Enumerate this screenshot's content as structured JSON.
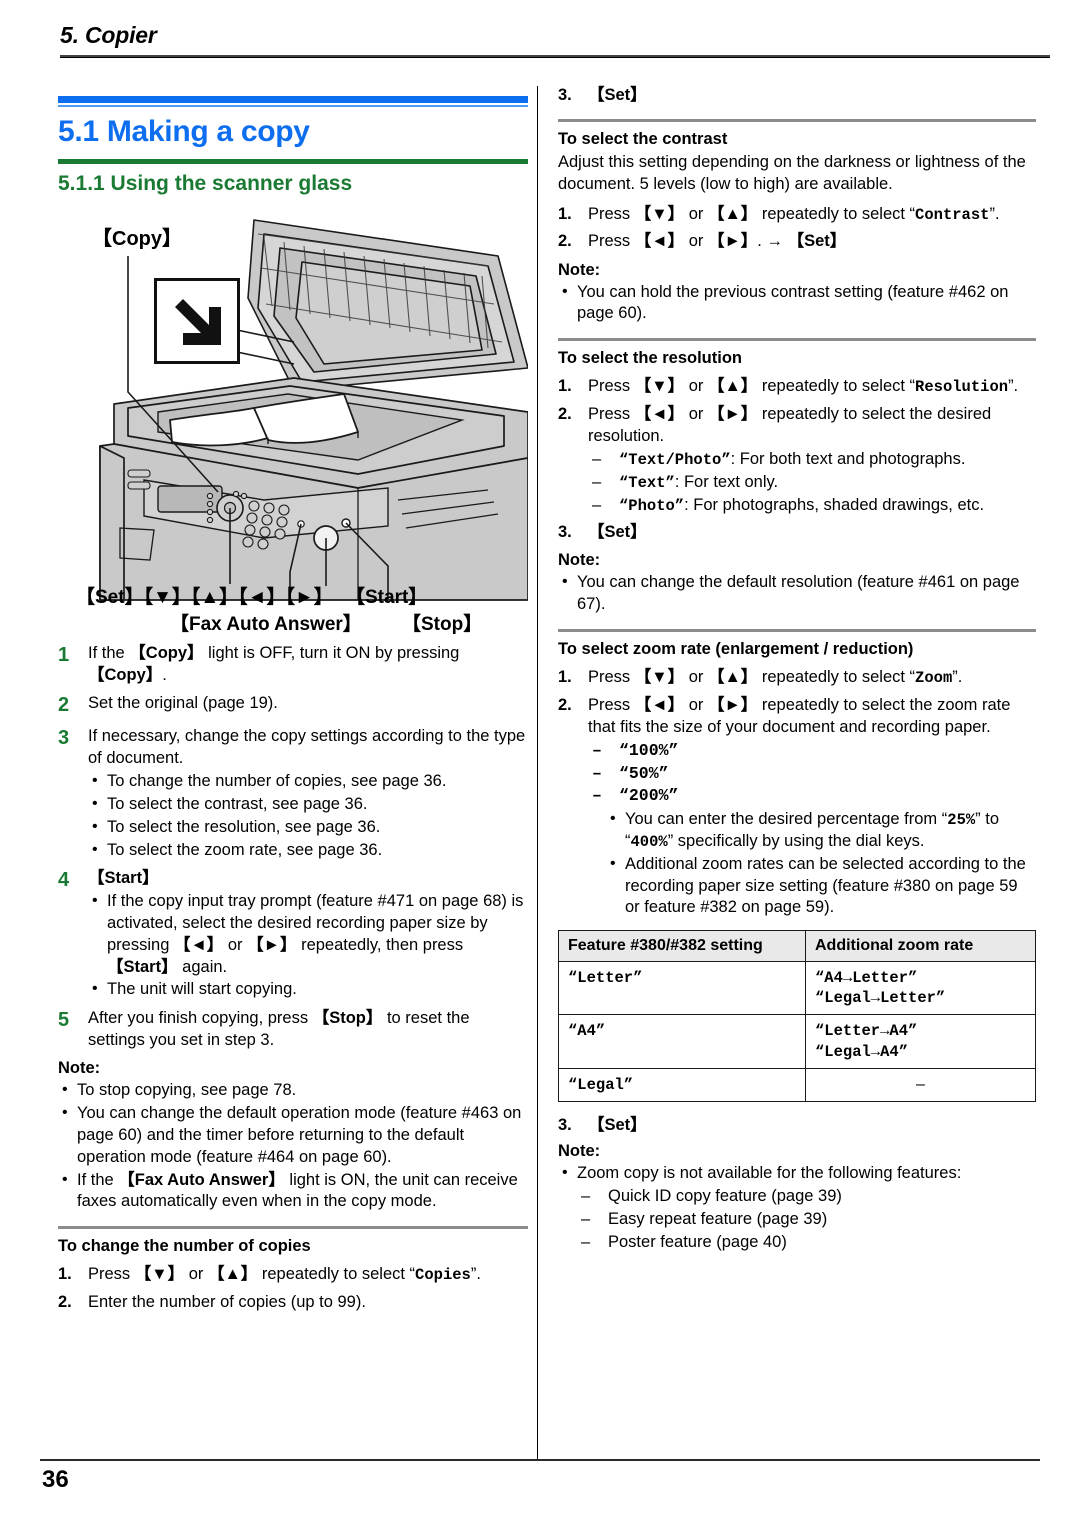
{
  "header": {
    "chapter": "5. Copier"
  },
  "footer": {
    "page_number": "36"
  },
  "left": {
    "h1": "5.1 Making a copy",
    "h2": "5.1.1 Using the scanner glass",
    "illustration": {
      "label_copy": "【Copy】",
      "label_keys": "【Set】【▼】【▲】【◄】【►】",
      "label_start": "【Start】",
      "label_fax_auto_answer": "【Fax Auto Answer】",
      "label_stop": "【Stop】",
      "arrow_icon": "down-right-arrow-icon"
    },
    "steps": [
      {
        "num": "1",
        "text_a": "If the ",
        "key_a": "【Copy】",
        "text_b": " light is OFF, turn it ON by pressing ",
        "key_b": "【Copy】",
        "text_c": "."
      },
      {
        "num": "2",
        "text": "Set the original (page 19)."
      },
      {
        "num": "3",
        "text": "If necessary, change the copy settings according to the type of document.",
        "bullets": [
          "To change the number of copies, see page 36.",
          "To select the contrast, see page 36.",
          "To select the resolution, see page 36.",
          "To select the zoom rate, see page 36."
        ]
      },
      {
        "num": "4",
        "key": "【Start】",
        "bullets_rich": [
          {
            "a": "If the copy input tray prompt (feature #471 on page 68) is activated, select the desired recording paper size by pressing ",
            "k1": "【◄】",
            "b": " or ",
            "k2": "【►】",
            "c": " repeatedly, then press ",
            "k3": "【Start】",
            "d": " again."
          },
          {
            "a": "The unit will start copying."
          }
        ]
      },
      {
        "num": "5",
        "text_a": "After you finish copying, press ",
        "key_a": "【Stop】",
        "text_b": " to reset the settings you set in step 3."
      }
    ],
    "note_label": "Note:",
    "notes": [
      {
        "a": "To stop copying, see page 78."
      },
      {
        "a": "You can change the default operation mode (feature #463 on page 60) and the timer before returning to the default operation mode (feature #464 on page 60)."
      },
      {
        "a": "If the ",
        "k1": "【Fax Auto Answer】",
        "b": " light is ON, the unit can receive faxes automatically even when in the copy mode."
      }
    ],
    "copies_section": {
      "heading": "To change the number of copies",
      "items": [
        {
          "n": "1.",
          "a": "Press ",
          "k1": "【▼】",
          "b": " or ",
          "k2": "【▲】",
          "c": " repeatedly to select “",
          "m": "Copies",
          "d": "”."
        },
        {
          "n": "2.",
          "a": "Enter the number of copies (up to 99)."
        }
      ]
    }
  },
  "right": {
    "top_step": {
      "n": "3.",
      "key": "【Set】"
    },
    "contrast_section": {
      "heading": "To select the contrast",
      "paragraph": "Adjust this setting depending on the darkness or lightness of the document. 5 levels (low to high) are available.",
      "items": [
        {
          "n": "1.",
          "a": "Press ",
          "k1": "【▼】",
          "b": " or ",
          "k2": "【▲】",
          "c": " repeatedly to select “",
          "m": "Contrast",
          "d": "”."
        },
        {
          "n": "2.",
          "a": "Press ",
          "k1": "【◄】",
          "b": " or ",
          "k2": "【►】",
          "c": ". → ",
          "k3": "【Set】"
        }
      ],
      "note_label": "Note:",
      "notes": [
        "You can hold the previous contrast setting (feature #462 on page 60)."
      ]
    },
    "resolution_section": {
      "heading": "To select the resolution",
      "item1": {
        "n": "1.",
        "a": "Press ",
        "k1": "【▼】",
        "b": " or ",
        "k2": "【▲】",
        "c": " repeatedly to select “",
        "m": "Resolution",
        "d": "”."
      },
      "item2": {
        "n": "2.",
        "a": "Press ",
        "k1": "【◄】",
        "b": " or ",
        "k2": "【►】",
        "c": " repeatedly to select the desired resolution."
      },
      "options": [
        {
          "m": "“Text/Photo”",
          "t": ": For both text and photographs."
        },
        {
          "m": "“Text”",
          "t": ": For text only."
        },
        {
          "m": "“Photo”",
          "t": ": For photographs, shaded drawings, etc."
        }
      ],
      "item3": {
        "n": "3.",
        "key": "【Set】"
      },
      "note_label": "Note:",
      "notes": [
        "You can change the default resolution (feature #461 on page 67)."
      ]
    },
    "zoom_section": {
      "heading": "To select zoom rate (enlargement / reduction)",
      "item1": {
        "n": "1.",
        "a": "Press ",
        "k1": "【▼】",
        "b": " or ",
        "k2": "【▲】",
        "c": " repeatedly to select “",
        "m": "Zoom",
        "d": "”."
      },
      "item2": {
        "n": "2.",
        "a": "Press ",
        "k1": "【◄】",
        "b": " or ",
        "k2": "【►】",
        "c": " repeatedly to select the zoom rate that fits the size of your document and recording paper."
      },
      "rates": [
        "“100%”",
        "“50%”",
        "“200%”"
      ],
      "bullets": [
        {
          "a": "You can enter the desired percentage from “",
          "m1": "25%",
          "b": "” to “",
          "m2": "400%",
          "c": "” specifically by using the dial keys."
        },
        {
          "a": "Additional zoom rates can be selected according to the recording paper size setting (feature #380 on page 59 or feature #382 on page 59)."
        }
      ],
      "table": {
        "headers": [
          "Feature #380/#382 setting",
          "Additional zoom rate"
        ],
        "rows": [
          {
            "setting": "“Letter”",
            "rates": [
              "“A4→Letter”",
              "“Legal→Letter”"
            ]
          },
          {
            "setting": "“A4”",
            "rates": [
              "“Letter→A4”",
              "“Legal→A4”"
            ]
          },
          {
            "setting": "“Legal”",
            "rates": [
              "–"
            ]
          }
        ]
      },
      "item3": {
        "n": "3.",
        "key": "【Set】"
      },
      "note_label": "Note:",
      "note_lead": "Zoom copy is not available for the following features:",
      "note_sub": [
        "Quick ID copy feature (page 39)",
        "Easy repeat feature (page 39)",
        "Poster feature (page 40)"
      ]
    }
  }
}
